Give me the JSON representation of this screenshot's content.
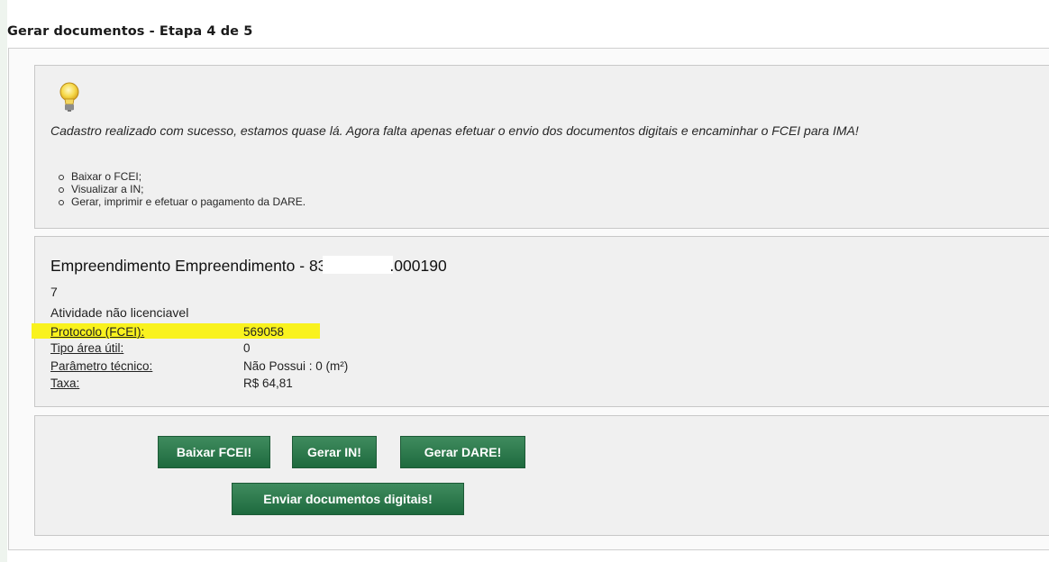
{
  "page_title": "Gerar documentos - Etapa 4 de 5",
  "info": {
    "icon": "lightbulb-icon",
    "message": "Cadastro realizado com sucesso, estamos quase lá. Agora falta apenas efetuar o envio dos documentos digitais e encaminhar o FCEI para IMA!",
    "steps": [
      "Baixar o FCEI;",
      "Visualizar a IN;",
      "Gerar, imprimir e efetuar o pagamento da DARE."
    ]
  },
  "empreendimento": {
    "title_prefix": "Empreendimento Empreendimento - 83",
    "title_suffix": ".000190",
    "number": "7",
    "activity": "Atividade não licenciavel",
    "fields": [
      {
        "label": "Protocolo (FCEI):",
        "value": "569058"
      },
      {
        "label": "Tipo área útil:",
        "value": "0"
      },
      {
        "label": "Parâmetro técnico:",
        "value": "Não Possui : 0 (m²)"
      },
      {
        "label": "Taxa:",
        "value": "R$ 64,81"
      }
    ],
    "highlight_color": "#f9f21e"
  },
  "actions": {
    "baixar_fcei": "Baixar FCEI!",
    "gerar_in": "Gerar IN!",
    "gerar_dare": "Gerar DARE!",
    "enviar_documentos": "Enviar documentos digitais!"
  },
  "colors": {
    "button_green": "#2f7a4d",
    "panel_bg": "#f0f0f0"
  }
}
